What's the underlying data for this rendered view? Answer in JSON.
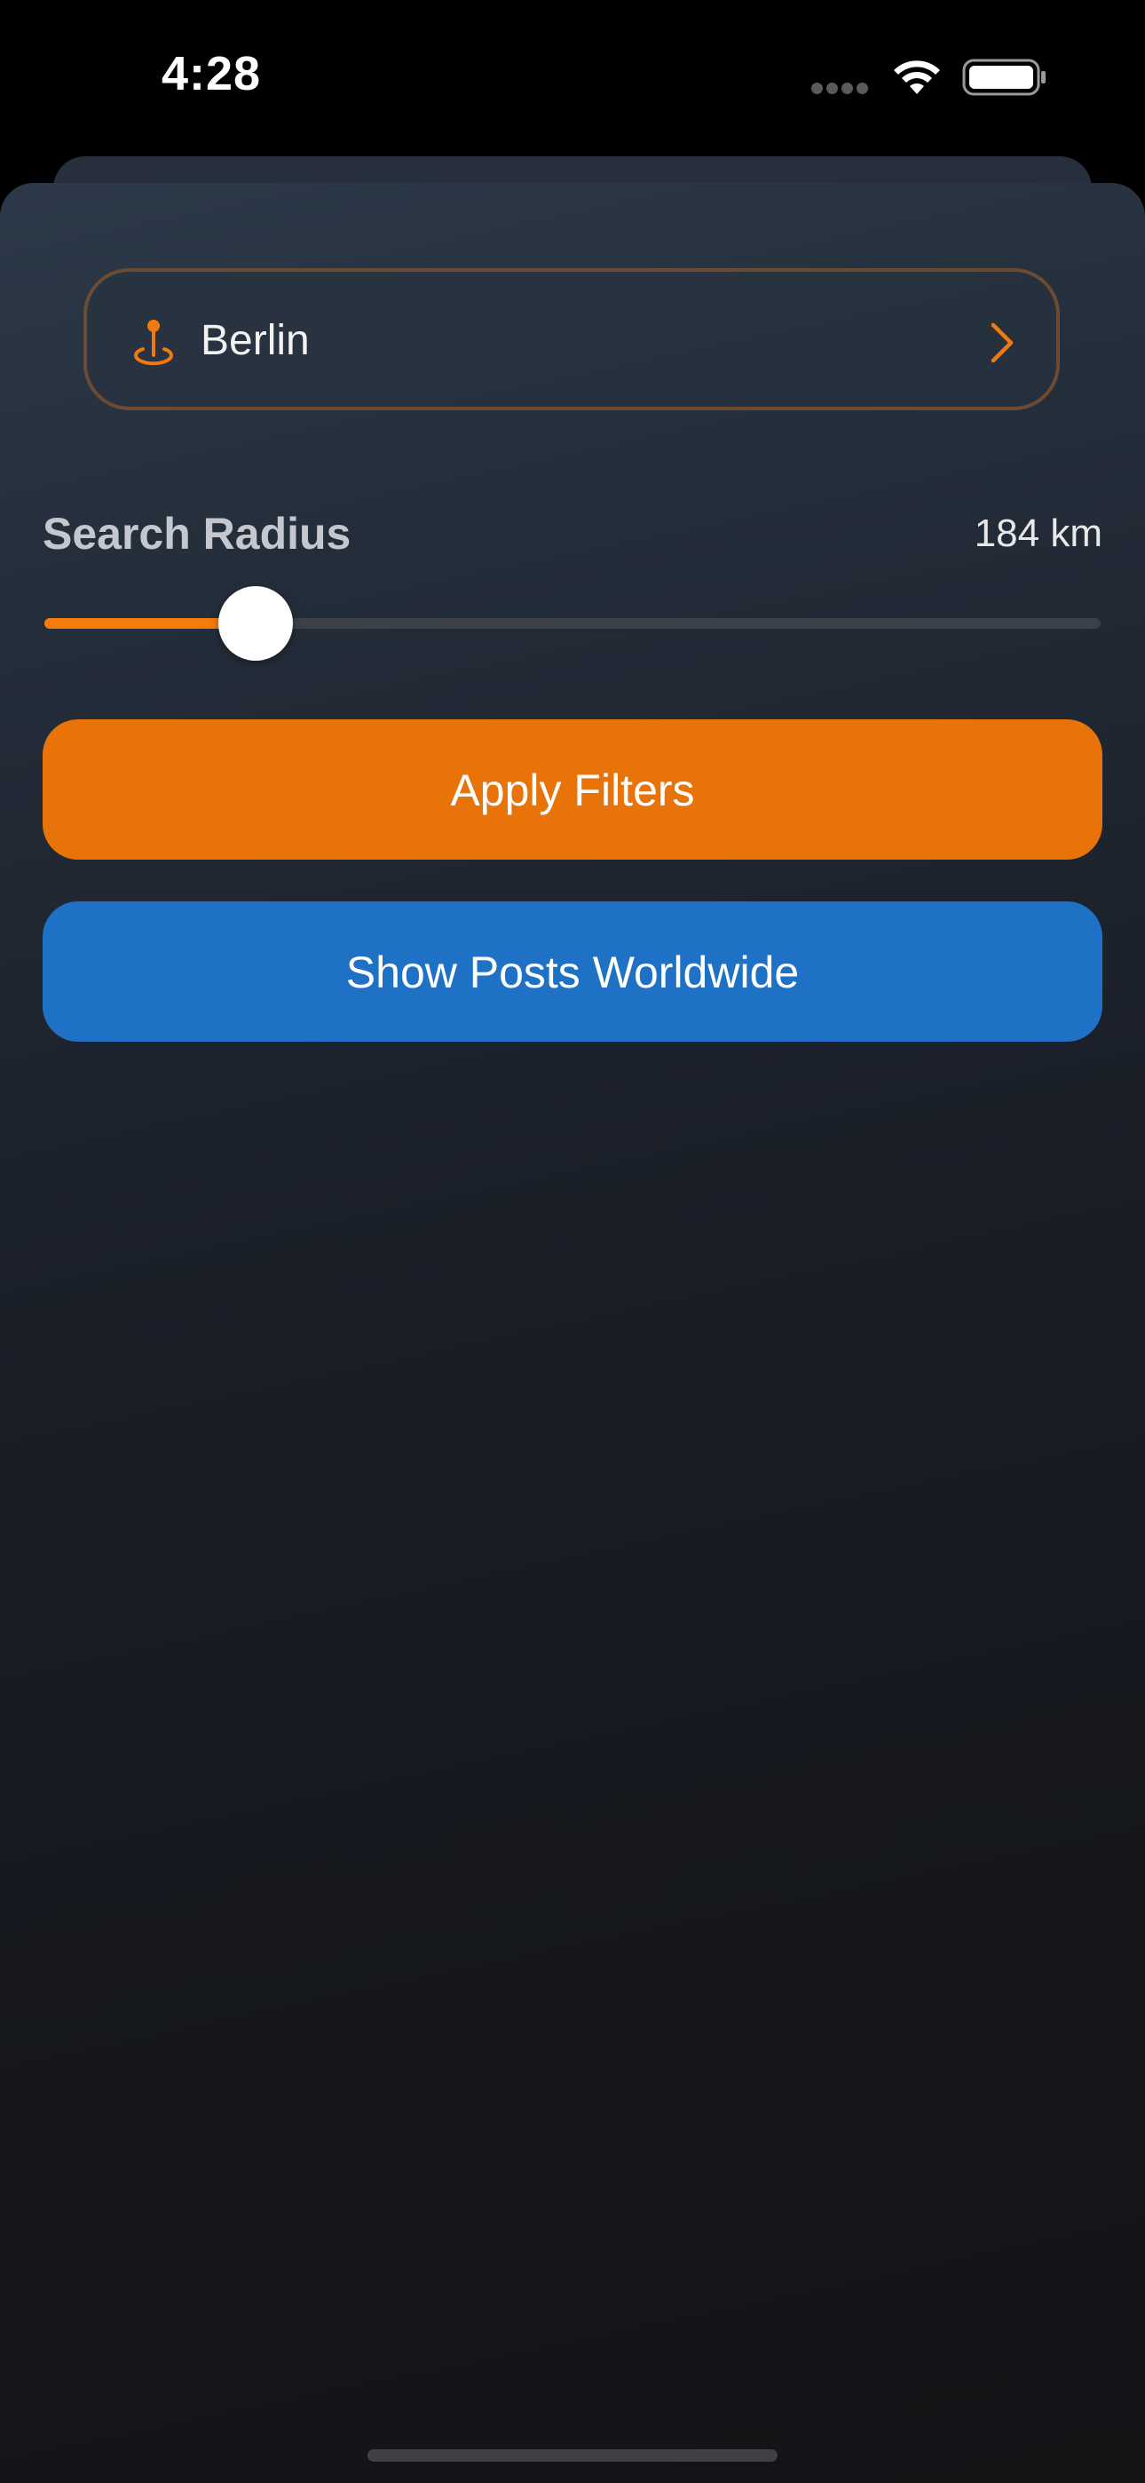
{
  "status_bar": {
    "time": "4:28",
    "wifi_icon": "wifi-icon",
    "battery_icon": "battery-icon"
  },
  "location": {
    "icon": "location-pin-icon",
    "value": "Berlin",
    "chevron_icon": "chevron-right-icon"
  },
  "radius": {
    "label": "Search Radius",
    "value_text": "184 km",
    "slider_fraction": 0.2
  },
  "buttons": {
    "apply_label": "Apply Filters",
    "worldwide_label": "Show Posts Worldwide"
  },
  "colors": {
    "accent_orange": "#e87308",
    "slider_orange": "#f57c0a",
    "primary_blue": "#1f71c6",
    "location_border": "#6d4b33"
  }
}
